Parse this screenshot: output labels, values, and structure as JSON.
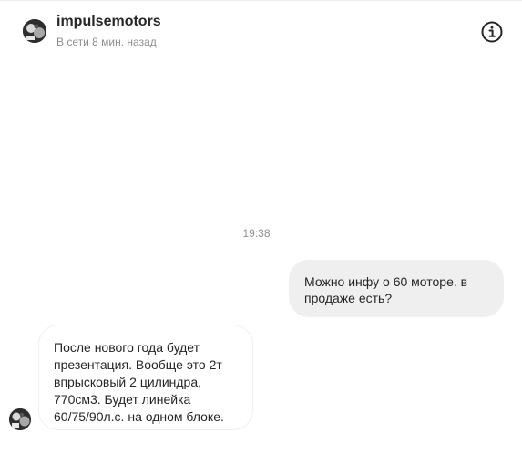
{
  "header": {
    "username": "impulsemotors",
    "status": "В сети 8 мин. назад",
    "avatar_icon": "user-avatar",
    "info_icon": "info-icon"
  },
  "thread": {
    "timestamp": "19:38",
    "messages": [
      {
        "direction": "outgoing",
        "text": "Можно инфу о 60 моторе. в\nпродаже есть?"
      },
      {
        "direction": "incoming",
        "text": "После нового года будет\nпрезентация. Вообще это 2т\nвпрысковый 2 цилиндра,\n770см3. Будет линейка\n60/75/90л.с. на одном блоке."
      }
    ]
  },
  "colors": {
    "outgoing_bubble": "#efefef",
    "incoming_border": "#efefef",
    "muted_text": "#8e8e8e",
    "text": "#262626"
  }
}
